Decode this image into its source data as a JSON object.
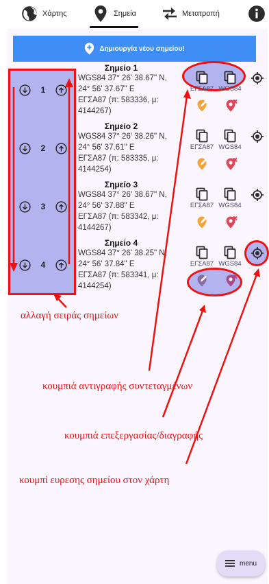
{
  "nav": {
    "tabs": [
      {
        "label": "Χάρτης",
        "icon": "globe-icon"
      },
      {
        "label": "Σημεία",
        "icon": "location-pin-icon",
        "active": true
      },
      {
        "label": "Μετατροπή",
        "icon": "swap-arrows-icon"
      }
    ],
    "info_icon": "info-icon"
  },
  "create_button": {
    "label": "Δημιουργία νέου σημείου!",
    "icon": "add-location-icon"
  },
  "points": [
    {
      "index": "1",
      "title": "Σημείο 1",
      "wgs_line1": "WGS84 37° 26' 38.67\" N,",
      "wgs_line2": "24° 56' 37.67\" E",
      "egsa_line1": "ΕΓΣΑ87 (π: 583336, μ:",
      "egsa_line2": "4144267)"
    },
    {
      "index": "2",
      "title": "Σημείο 2",
      "wgs_line1": "WGS84 37° 26' 38.26\" N,",
      "wgs_line2": "24° 56' 37.61\" E",
      "egsa_line1": "ΕΓΣΑ87 (π: 583335, μ:",
      "egsa_line2": "4144254)"
    },
    {
      "index": "3",
      "title": "Σημείο 3",
      "wgs_line1": "WGS84 37° 26' 38.67\" N,",
      "wgs_line2": "24° 56' 37.88\" E",
      "egsa_line1": "ΕΓΣΑ87 (π: 583342, μ:",
      "egsa_line2": "4144267)"
    },
    {
      "index": "4",
      "title": "Σημείο 4",
      "wgs_line1": "WGS84 37° 26' 38.25\" N,",
      "wgs_line2": "24° 56' 37.84\" E",
      "egsa_line1": "ΕΓΣΑ87 (π: 583341, μ:",
      "egsa_line2": "4144254)"
    }
  ],
  "copy_labels": {
    "egsa": "ΕΓΣΑ87",
    "wgs": "WGS84"
  },
  "icons": {
    "copy": "copy-icon",
    "edit": "edit-location-icon",
    "delete": "delete-location-icon",
    "locate": "locate-target-icon",
    "move_down": "arrow-down-circle-icon",
    "move_up": "arrow-up-circle-icon"
  },
  "annotations": {
    "reorder": "αλλαγή σειράς σημείων",
    "copy": "κουμπιά αντιγραφής συντεταγμένων",
    "edit_delete": "κουμπιά επεξεργασίας/διαγραφής",
    "locate": "κουμπί ευρεσης σημείου στον χάρτη"
  },
  "colors": {
    "accent_blue": "#3f8ef5",
    "edit_orange": "#f2a33a",
    "delete_red": "#e0455a",
    "annotation_red": "#ee1111",
    "highlight_lavender": "#b3b3f0",
    "edit_muted": "#8a6aa0",
    "delete_muted": "#a84a8a"
  },
  "menu": {
    "label": "menu",
    "icon": "menu-lines-icon"
  }
}
